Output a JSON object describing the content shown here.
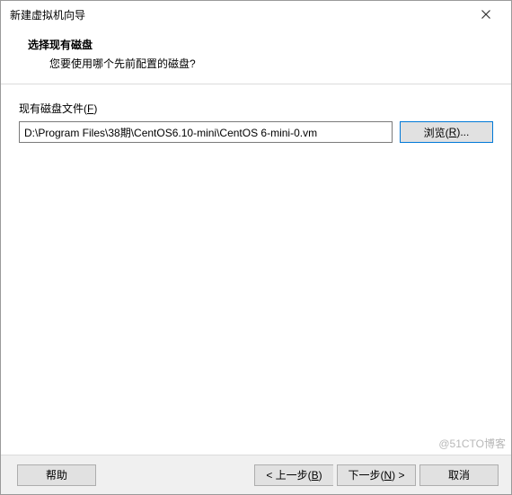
{
  "window": {
    "title": "新建虚拟机向导"
  },
  "header": {
    "title": "选择现有磁盘",
    "subtitle": "您要使用哪个先前配置的磁盘?"
  },
  "field": {
    "label_prefix": "现有磁盘文件(",
    "label_accel": "F",
    "label_suffix": ")",
    "path_value": "D:\\Program Files\\38期\\CentOS6.10-mini\\CentOS 6-mini-0.vm",
    "browse_prefix": "浏览(",
    "browse_accel": "R",
    "browse_suffix": ")..."
  },
  "footer": {
    "help": "帮助",
    "back_prefix": "< 上一步(",
    "back_accel": "B",
    "back_suffix": ")",
    "next_prefix": "下一步(",
    "next_accel": "N",
    "next_suffix": ") >",
    "cancel": "取消"
  },
  "watermark": "@51CTO博客"
}
